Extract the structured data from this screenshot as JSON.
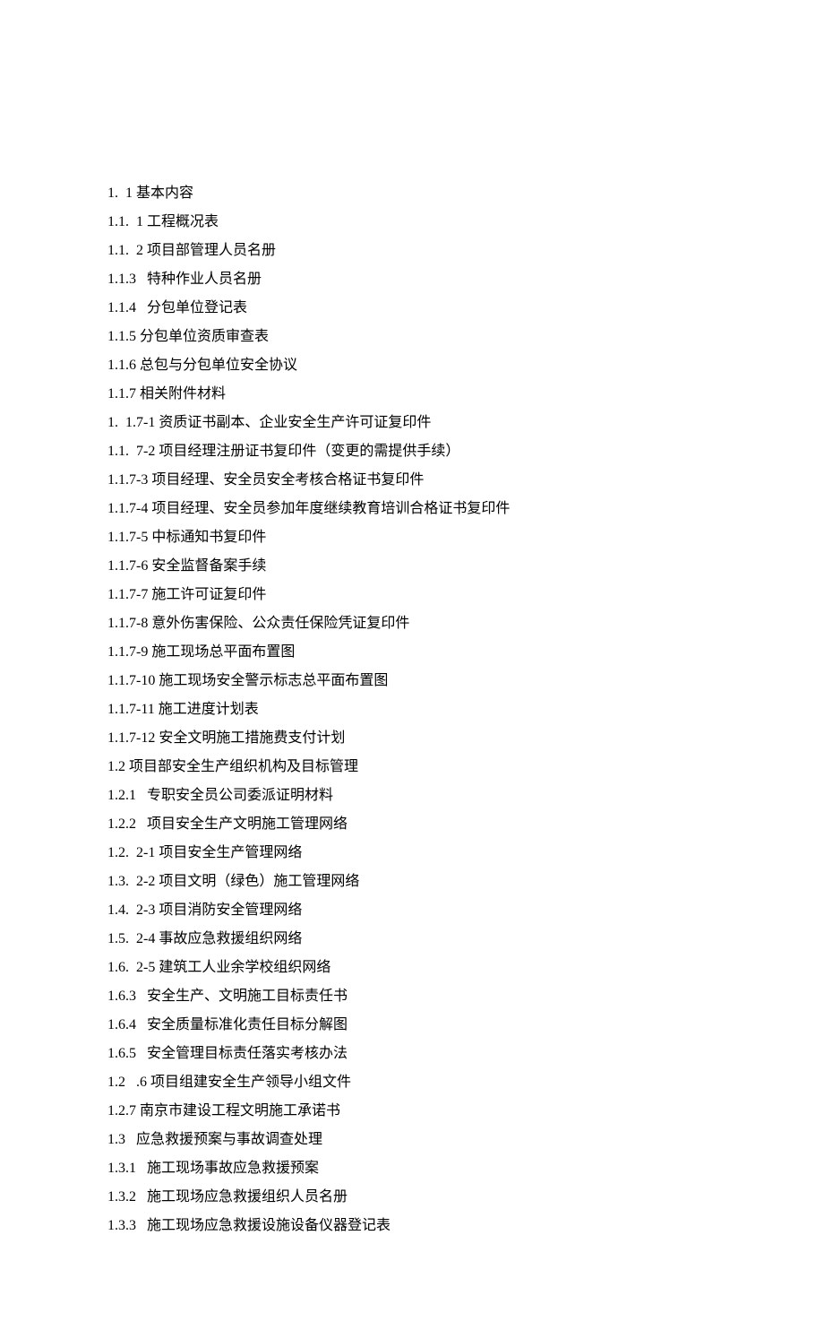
{
  "lines": [
    "1.  1 基本内容",
    "1.1.  1 工程概况表",
    "1.1.  2 项目部管理人员名册",
    "1.1.3   特种作业人员名册",
    "1.1.4   分包单位登记表",
    "1.1.5 分包单位资质审查表",
    "1.1.6 总包与分包单位安全协议",
    "1.1.7 相关附件材料",
    "1.  1.7-1 资质证书副本、企业安全生产许可证复印件",
    "1.1.  7-2 项目经理注册证书复印件（变更的需提供手续）",
    "1.1.7-3 项目经理、安全员安全考核合格证书复印件",
    "1.1.7-4 项目经理、安全员参加年度继续教育培训合格证书复印件",
    "1.1.7-5 中标通知书复印件",
    "1.1.7-6 安全监督备案手续",
    "1.1.7-7 施工许可证复印件",
    "1.1.7-8 意外伤害保险、公众责任保险凭证复印件",
    "1.1.7-9 施工现场总平面布置图",
    "1.1.7-10 施工现场安全警示标志总平面布置图",
    "1.1.7-11 施工进度计划表",
    "1.1.7-12 安全文明施工措施费支付计划",
    "1.2 项目部安全生产组织机构及目标管理",
    "1.2.1   专职安全员公司委派证明材料",
    "1.2.2   项目安全生产文明施工管理网络",
    "1.2.  2-1 项目安全生产管理网络",
    "1.3.  2-2 项目文明（绿色）施工管理网络",
    "1.4.  2-3 项目消防安全管理网络",
    "1.5.  2-4 事故应急救援组织网络",
    "1.6.  2-5 建筑工人业余学校组织网络",
    "1.6.3   安全生产、文明施工目标责任书",
    "1.6.4   安全质量标准化责任目标分解图",
    "1.6.5   安全管理目标责任落实考核办法",
    "1.2   .6 项目组建安全生产领导小组文件",
    "1.2.7 南京市建设工程文明施工承诺书",
    "1.3   应急救援预案与事故调查处理",
    "1.3.1   施工现场事故应急救援预案",
    "1.3.2   施工现场应急救援组织人员名册",
    "1.3.3   施工现场应急救援设施设备仪器登记表"
  ]
}
